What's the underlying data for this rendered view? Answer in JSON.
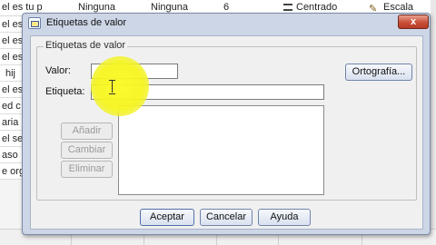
{
  "background": {
    "header_row": [
      "el es tu pe",
      "Ninguna",
      "Ninguna",
      "6",
      "Centrado",
      "Escala"
    ],
    "left_column": [
      "el es",
      "el es",
      "el es",
      "hij",
      "el es",
      "ed c",
      "aria",
      "el se",
      "aso",
      "e org"
    ]
  },
  "dialog": {
    "title": "Etiquetas de valor",
    "close_label": "x",
    "group_label": "Etiquetas de valor",
    "valor_label": "Valor:",
    "valor_value": "",
    "etiqueta_label": "Etiqueta:",
    "etiqueta_value": "",
    "ortografia_button": "Ortografía...",
    "anadir_button": "Añadir",
    "cambiar_button": "Cambiar",
    "eliminar_button": "Eliminar",
    "aceptar_button": "Aceptar",
    "cancelar_button": "Cancelar",
    "ayuda_button": "Ayuda"
  },
  "colors": {
    "dialog_frame": "#cdd6e6",
    "highlight": "#f5f51e",
    "close_button": "#c9503a"
  },
  "icons": [
    "dialog-app-icon",
    "centered-align-icon",
    "scale-pencil-icon",
    "text-cursor"
  ]
}
